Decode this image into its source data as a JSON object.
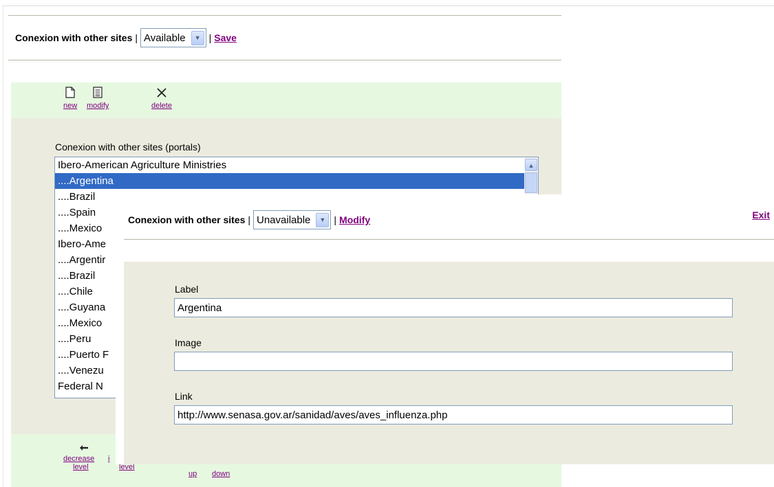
{
  "background": {
    "header": {
      "label": "Conexion with other sites",
      "separator": "|",
      "select_value": "Available",
      "separator2": "|",
      "save_link": "Save"
    },
    "toolbar_top": [
      {
        "icon": "new-document-icon",
        "label": "new"
      },
      {
        "icon": "modify-document-icon",
        "label": "modify"
      },
      {
        "icon": "delete-x-icon",
        "label": "delete"
      }
    ],
    "list_label": "Conexion with other sites (portals)",
    "list_items": [
      "Ibero-American Agriculture Ministries",
      "....Argentina",
      "....Brazil",
      "....Spain",
      "....Mexico",
      "Ibero-Ame",
      "....Argentir",
      "....Brazil",
      "....Chile",
      "....Guyana",
      "....Mexico",
      "....Peru",
      "....Puerto F",
      "....Venezu",
      "Federal N"
    ],
    "toolbar_bottom": {
      "decrease_line1": "decrease",
      "decrease_line2": "level",
      "increase_line1": "i",
      "increase_line2": "level",
      "up": "up",
      "down": "down"
    }
  },
  "dialog": {
    "header": {
      "label": "Conexion with other sites",
      "separator": "|",
      "select_value": "Unavailable",
      "separator2": "|",
      "modify_link": "Modify"
    },
    "exit_link": "Exit",
    "fields": {
      "label_title": "Label",
      "label_value": "Argentina",
      "image_title": "Image",
      "image_value": "",
      "link_title": "Link",
      "link_value": "http://www.senasa.gov.ar/sanidad/aves/aves_influenza.php"
    }
  },
  "colors": {
    "toolbar_bg": "#e6f9e0",
    "panel_bg": "#ecebdf",
    "link": "#800080",
    "selection": "#316ac5"
  }
}
